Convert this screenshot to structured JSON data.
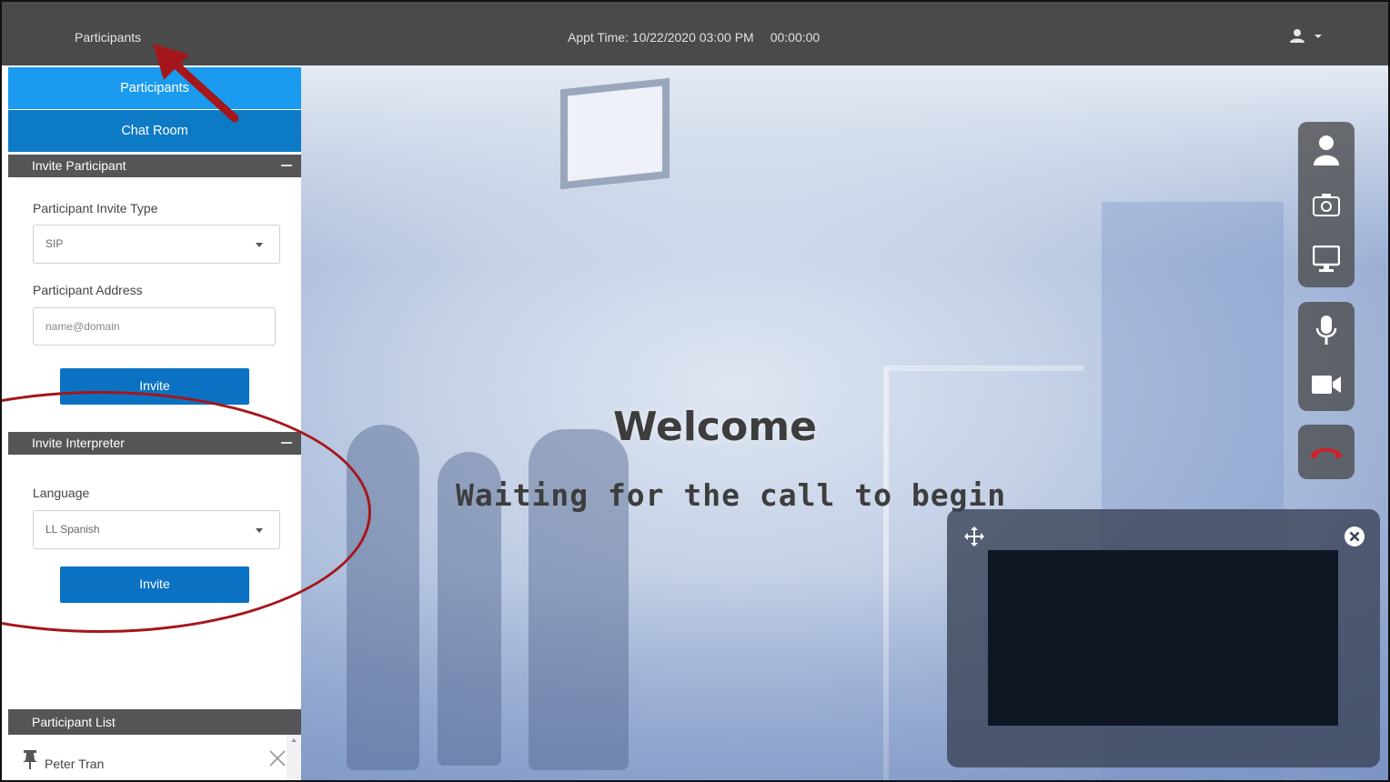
{
  "topbar": {
    "title": "Participants",
    "appt_label": "Appt Time: 10/22/2020 03:00 PM",
    "timer": "00:00:00",
    "user_icon": "user-icon",
    "user_caret_icon": "caret-down-icon"
  },
  "sidebar": {
    "tabs": [
      {
        "label": "Participants",
        "active": true
      },
      {
        "label": "Chat Room",
        "active": false
      }
    ],
    "invite_participant": {
      "header": "Invite Participant",
      "type_label": "Participant Invite Type",
      "type_value": "SIP",
      "address_label": "Participant Address",
      "address_placeholder": "name@domain",
      "invite_button": "Invite"
    },
    "invite_interpreter": {
      "header": "Invite Interpreter",
      "language_label": "Language",
      "language_value": "LL Spanish",
      "invite_button": "Invite"
    },
    "participant_list": {
      "header": "Participant List",
      "items": [
        {
          "name": "Peter Tran",
          "pin_icon": "pin-icon",
          "remove_icon": "close-icon"
        }
      ]
    }
  },
  "stage": {
    "welcome": "Welcome",
    "waiting": "Waiting for the call to begin"
  },
  "controls": {
    "participants_icon": "person-icon",
    "snapshot_icon": "camera-icon",
    "screenshare_icon": "monitor-icon",
    "mic_icon": "microphone-icon",
    "video_icon": "video-camera-icon",
    "hangup_icon": "hang-up-icon",
    "hangup_color": "#d0202a"
  },
  "selfview": {
    "move_icon": "move-icon",
    "close_icon": "close-circle-icon"
  },
  "colors": {
    "topbar": "#4a4a4a",
    "tab_active": "#1a9bf0",
    "tab_inactive": "#0d7ac6",
    "button": "#0b72c3",
    "section_header": "#555555",
    "annotation": "#a5161b"
  }
}
